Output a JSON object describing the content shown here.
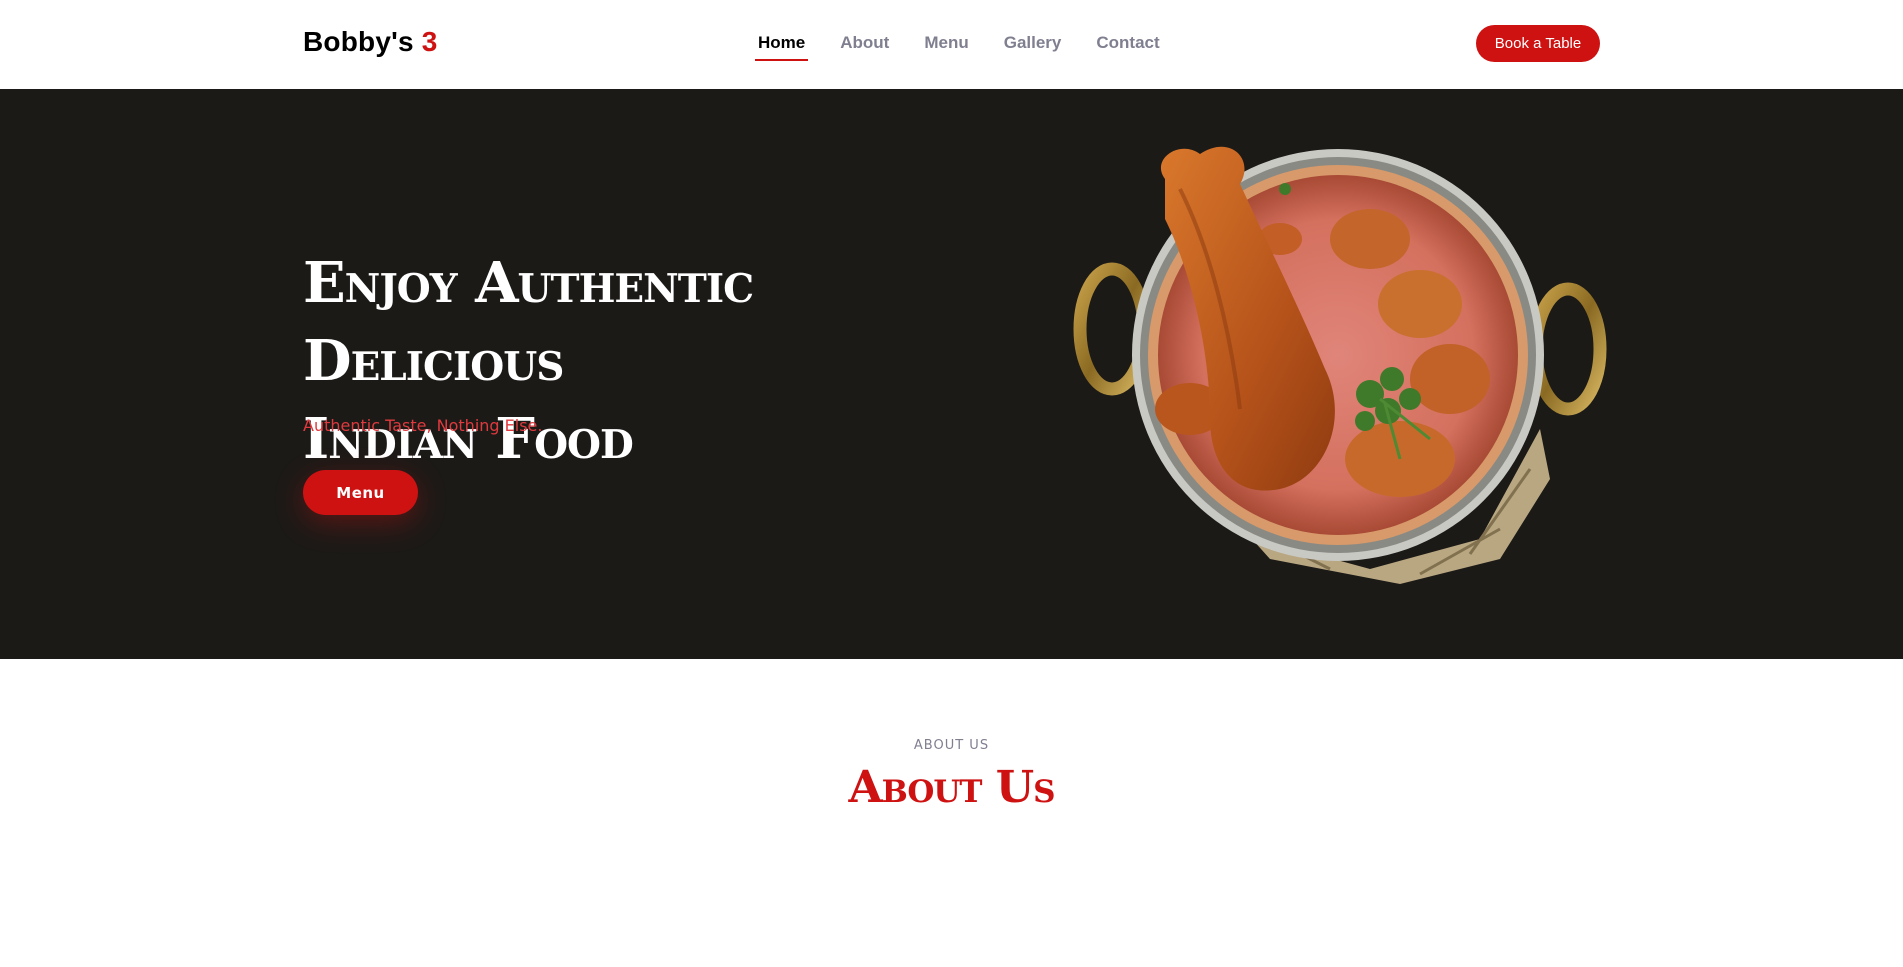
{
  "header": {
    "logo_text": "Bobby's",
    "logo_accent": "3",
    "nav": [
      {
        "label": "Home",
        "active": true
      },
      {
        "label": "About",
        "active": false
      },
      {
        "label": "Menu",
        "active": false
      },
      {
        "label": "Gallery",
        "active": false
      },
      {
        "label": "Contact",
        "active": false
      }
    ],
    "cta_label": "Book a Table"
  },
  "hero": {
    "title_line1": "Enjoy Authentic Delicious",
    "title_line2": "Indian Food",
    "subtitle": "Authentic Taste, Nothing Else.",
    "button_label": "Menu"
  },
  "about": {
    "eyebrow": "ABOUT US",
    "title": "About Us"
  },
  "colors": {
    "accent": "#ce1212",
    "hero_bg": "#1c1a17",
    "nav_inactive": "#7f7f90"
  }
}
